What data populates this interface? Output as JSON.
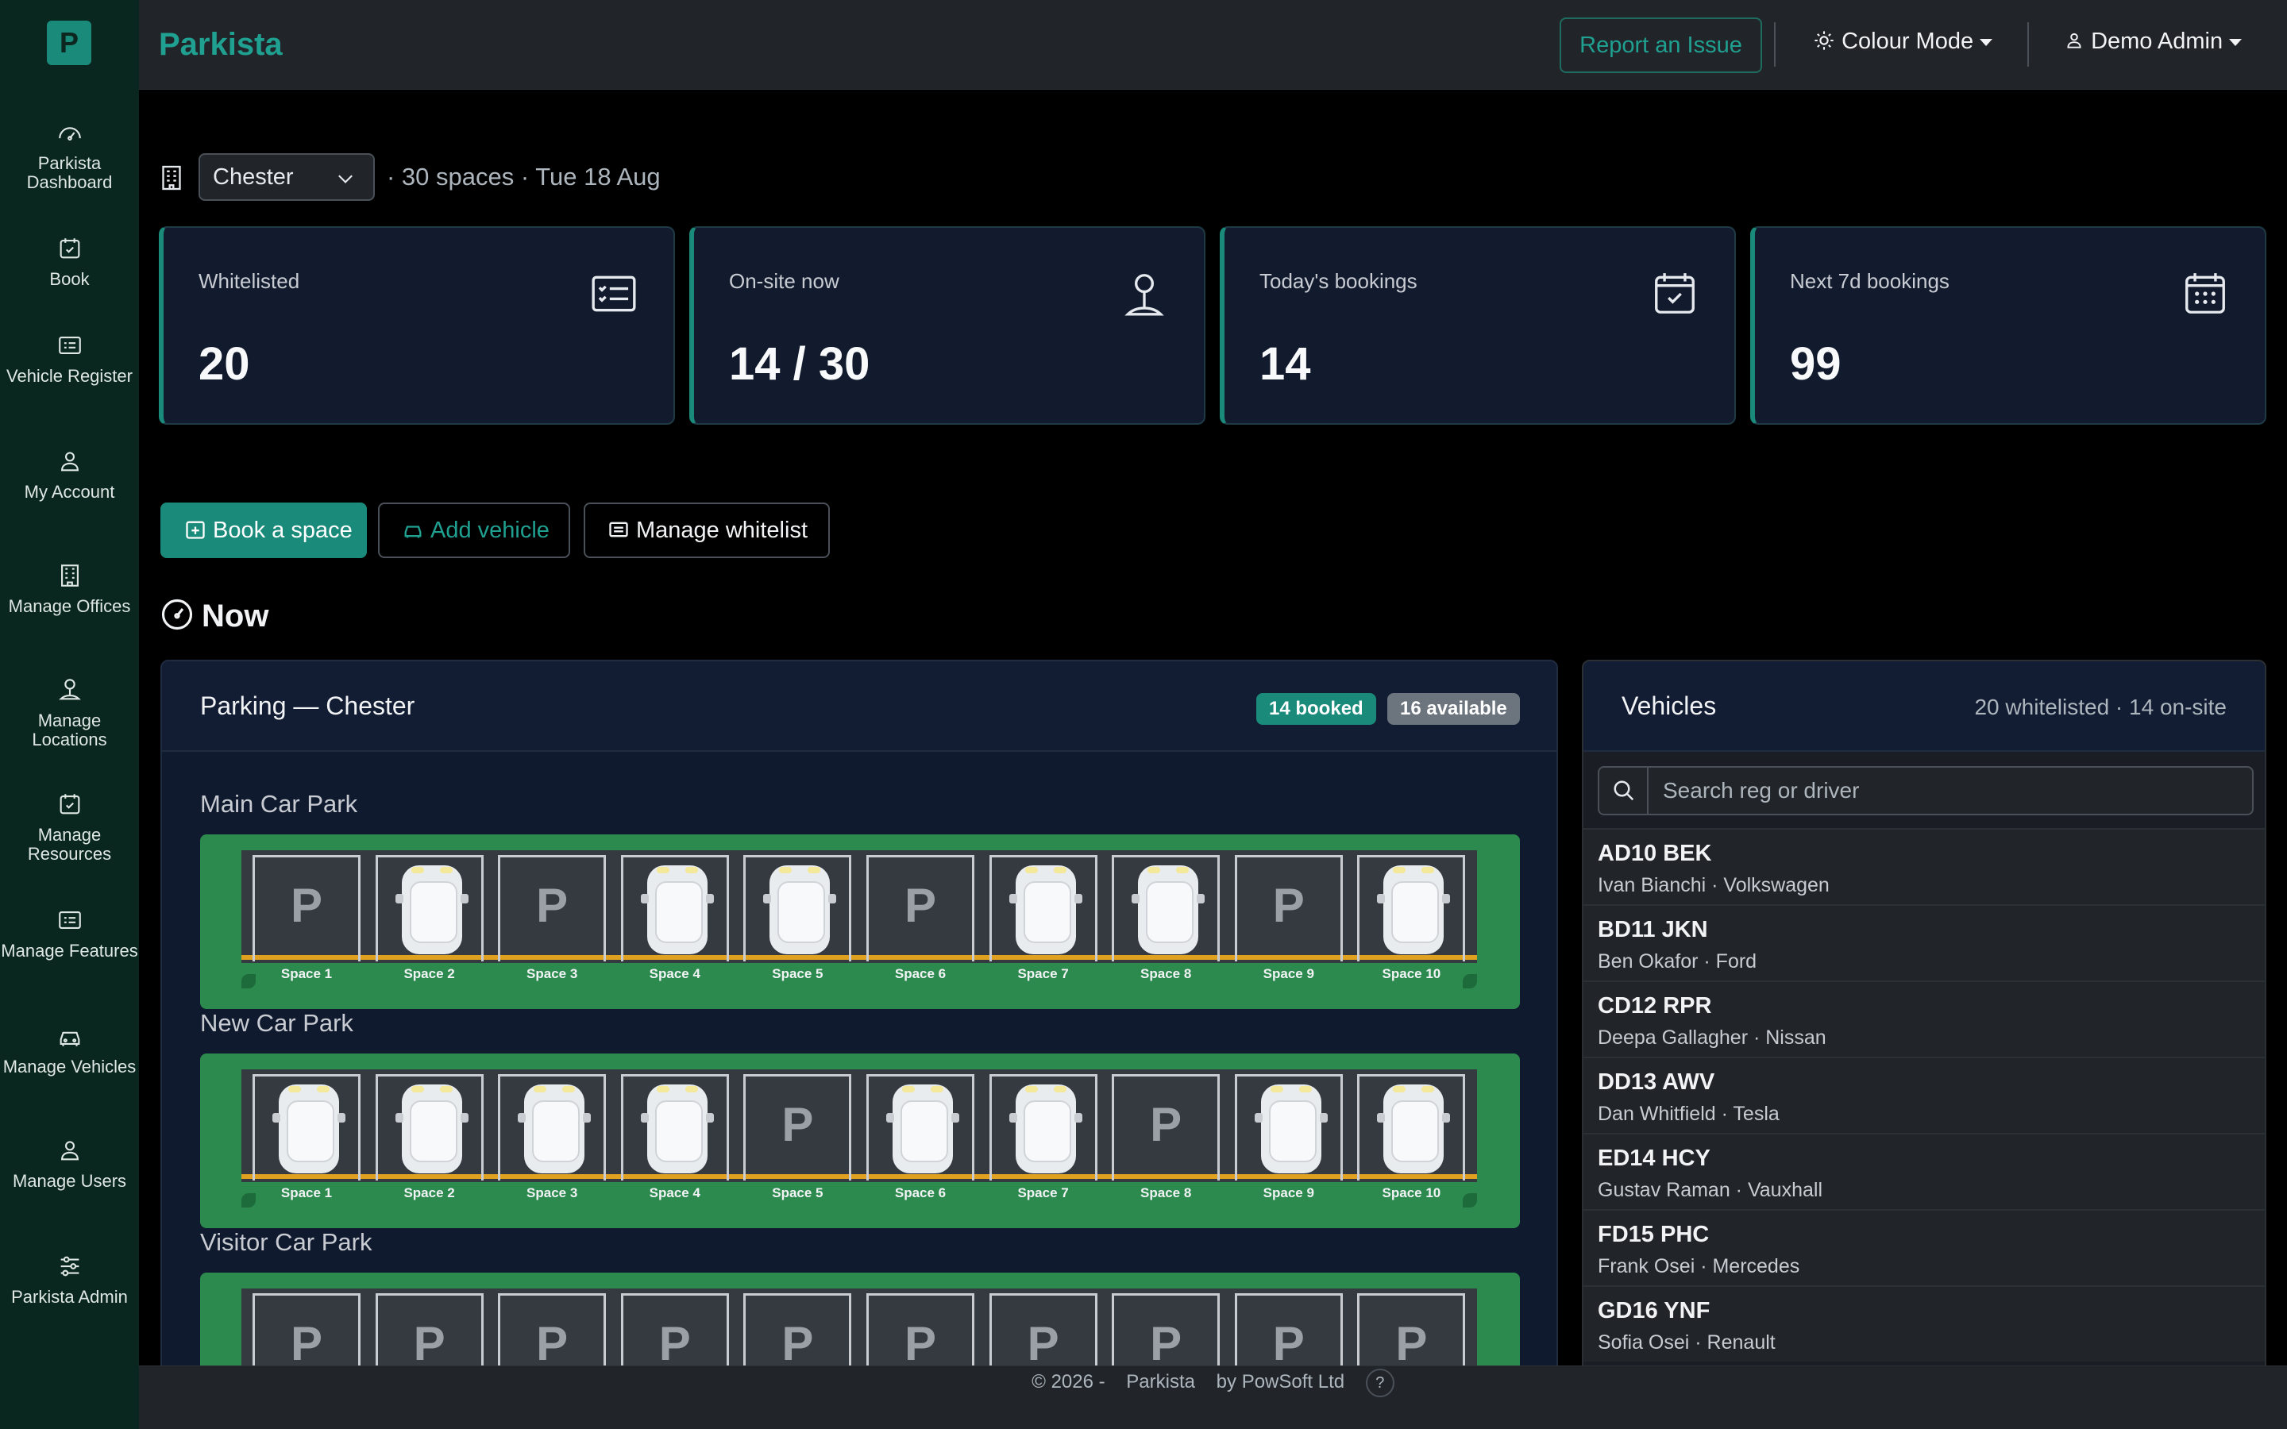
{
  "sidebar": {
    "logo": "P",
    "items": [
      {
        "label": "Parkista Dashboard",
        "icon": "speedometer-icon"
      },
      {
        "label": "Book",
        "icon": "calendar-check-icon"
      },
      {
        "label": "Vehicle Register",
        "icon": "list-card-icon"
      },
      {
        "label": "My Account",
        "icon": "person-icon"
      },
      {
        "label": "Manage Offices",
        "icon": "building-icon"
      },
      {
        "label": "Manage Locations",
        "icon": "map-pin-person-icon"
      },
      {
        "label": "Manage Resources",
        "icon": "calendar-check-icon"
      },
      {
        "label": "Manage Features",
        "icon": "list-card-icon"
      },
      {
        "label": "Manage Vehicles",
        "icon": "car-icon"
      },
      {
        "label": "Manage Users",
        "icon": "person-icon"
      },
      {
        "label": "Parkista Admin",
        "icon": "sliders-icon"
      }
    ]
  },
  "header": {
    "brand": "Parkista",
    "report_label": "Report an Issue",
    "colour_mode_label": "Colour Mode",
    "user_label": "Demo Admin"
  },
  "filter": {
    "office": "Chester",
    "meta": "· 30 spaces · Tue 18 Aug"
  },
  "stats": [
    {
      "label": "Whitelisted",
      "value": "20",
      "icon": "checklist-icon"
    },
    {
      "label": "On-site now",
      "value": "14 / 30",
      "icon": "map-pin-person-icon"
    },
    {
      "label": "Today's bookings",
      "value": "14",
      "icon": "calendar-check-icon"
    },
    {
      "label": "Next 7d bookings",
      "value": "99",
      "icon": "calendar-grid-icon"
    }
  ],
  "actions": {
    "book": "Book a space",
    "add_vehicle": "Add vehicle",
    "manage_whitelist": "Manage whitelist"
  },
  "now_title": "Now",
  "parking": {
    "title": "Parking — Chester",
    "booked_badge": "14 booked",
    "available_badge": "16 available",
    "lots": [
      {
        "name": "Main Car Park",
        "bays": [
          {
            "label": "Space 1",
            "occupied": false
          },
          {
            "label": "Space 2",
            "occupied": true
          },
          {
            "label": "Space 3",
            "occupied": false
          },
          {
            "label": "Space 4",
            "occupied": true
          },
          {
            "label": "Space 5",
            "occupied": true
          },
          {
            "label": "Space 6",
            "occupied": false
          },
          {
            "label": "Space 7",
            "occupied": true
          },
          {
            "label": "Space 8",
            "occupied": true
          },
          {
            "label": "Space 9",
            "occupied": false
          },
          {
            "label": "Space 10",
            "occupied": true
          }
        ]
      },
      {
        "name": "New Car Park",
        "bays": [
          {
            "label": "Space 1",
            "occupied": true
          },
          {
            "label": "Space 2",
            "occupied": true
          },
          {
            "label": "Space 3",
            "occupied": true
          },
          {
            "label": "Space 4",
            "occupied": true
          },
          {
            "label": "Space 5",
            "occupied": false
          },
          {
            "label": "Space 6",
            "occupied": true
          },
          {
            "label": "Space 7",
            "occupied": true
          },
          {
            "label": "Space 8",
            "occupied": false
          },
          {
            "label": "Space 9",
            "occupied": true
          },
          {
            "label": "Space 10",
            "occupied": true
          }
        ]
      },
      {
        "name": "Visitor Car Park",
        "bays": [
          {
            "label": "",
            "occupied": false
          },
          {
            "label": "",
            "occupied": false
          },
          {
            "label": "",
            "occupied": false
          },
          {
            "label": "",
            "occupied": false
          },
          {
            "label": "",
            "occupied": false
          },
          {
            "label": "",
            "occupied": false
          },
          {
            "label": "",
            "occupied": false
          },
          {
            "label": "",
            "occupied": false
          },
          {
            "label": "",
            "occupied": false
          },
          {
            "label": "",
            "occupied": false
          }
        ]
      }
    ],
    "bay_free_glyph": "P"
  },
  "vehicles": {
    "title": "Vehicles",
    "summary": "20 whitelisted · 14 on-site",
    "search_placeholder": "Search reg or driver",
    "rows": [
      {
        "reg": "AD10 BEK",
        "sub": "Ivan Bianchi · Volkswagen"
      },
      {
        "reg": "BD11 JKN",
        "sub": "Ben Okafor · Ford"
      },
      {
        "reg": "CD12 RPR",
        "sub": "Deepa Gallagher · Nissan"
      },
      {
        "reg": "DD13 AWV",
        "sub": "Dan Whitfield · Tesla"
      },
      {
        "reg": "ED14 HCY",
        "sub": "Gustav Raman · Vauxhall"
      },
      {
        "reg": "FD15 PHC",
        "sub": "Frank Osei · Mercedes"
      },
      {
        "reg": "GD16 YNF",
        "sub": "Sofia Osei · Renault"
      }
    ]
  },
  "footer": {
    "copyright": "© 2026 -",
    "app": "Parkista",
    "by": "by PowSoft Ltd",
    "help": "?"
  }
}
